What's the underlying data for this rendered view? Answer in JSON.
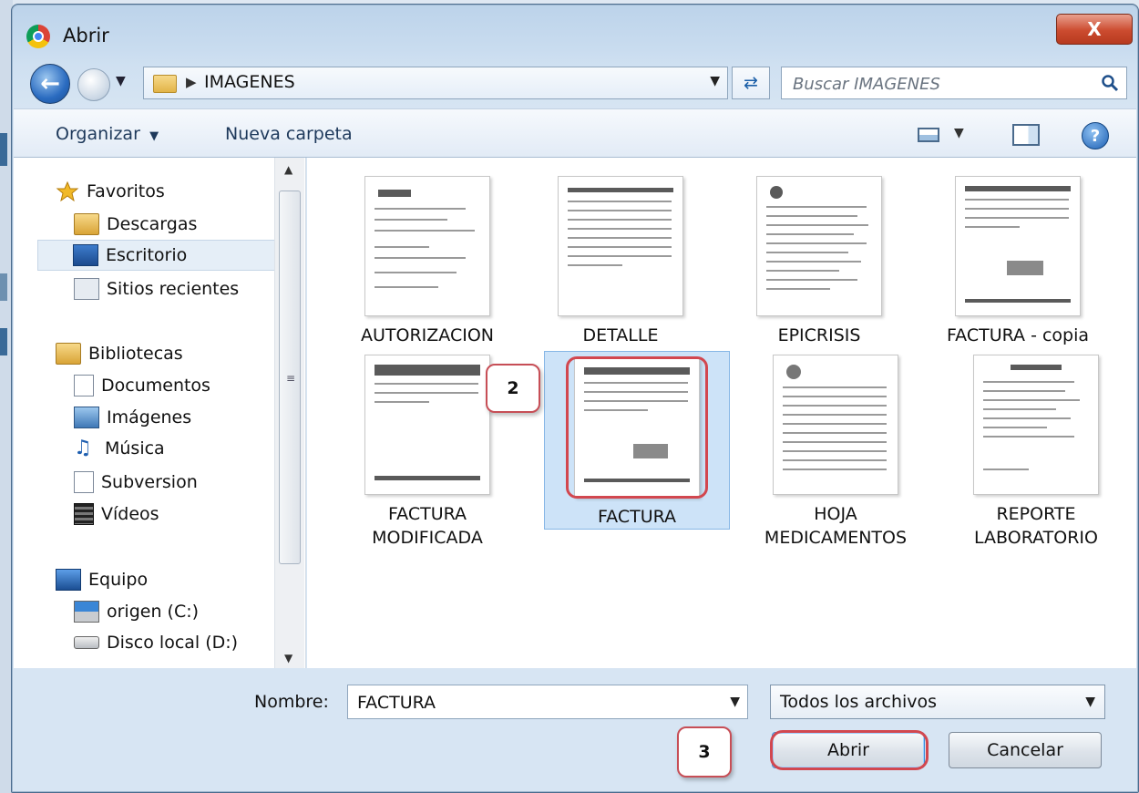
{
  "dialog": {
    "title": "Abrir",
    "close_glyph": "X"
  },
  "nav": {
    "breadcrumb": "IMAGENES",
    "search_placeholder": "Buscar IMAGENES"
  },
  "toolbar": {
    "organize_label": "Organizar",
    "new_folder_label": "Nueva carpeta"
  },
  "sidebar": {
    "favorites": "Favoritos",
    "downloads": "Descargas",
    "desktop": "Escritorio",
    "recent": "Sitios recientes",
    "libraries": "Bibliotecas",
    "documents": "Documentos",
    "images": "Imágenes",
    "music": "Música",
    "subversion": "Subversion",
    "videos": "Vídeos",
    "computer": "Equipo",
    "drive_c": "origen (C:)",
    "drive_d": "Disco local (D:)"
  },
  "files": [
    {
      "name": "AUTORIZACION",
      "name2": ""
    },
    {
      "name": "DETALLE",
      "name2": ""
    },
    {
      "name": "EPICRISIS",
      "name2": ""
    },
    {
      "name": "FACTURA - copia",
      "name2": ""
    },
    {
      "name": "FACTURA",
      "name2": "MODIFICADA"
    },
    {
      "name": "FACTURA",
      "name2": ""
    },
    {
      "name": "HOJA",
      "name2": "MEDICAMENTOS"
    },
    {
      "name": "REPORTE",
      "name2": "LABORATORIO"
    }
  ],
  "callouts": {
    "step2": "2",
    "step3": "3"
  },
  "bottom": {
    "name_label": "Nombre:",
    "name_value": "FACTURA",
    "file_type": "Todos los archivos",
    "open_label": "Abrir",
    "cancel_label": "Cancelar"
  }
}
